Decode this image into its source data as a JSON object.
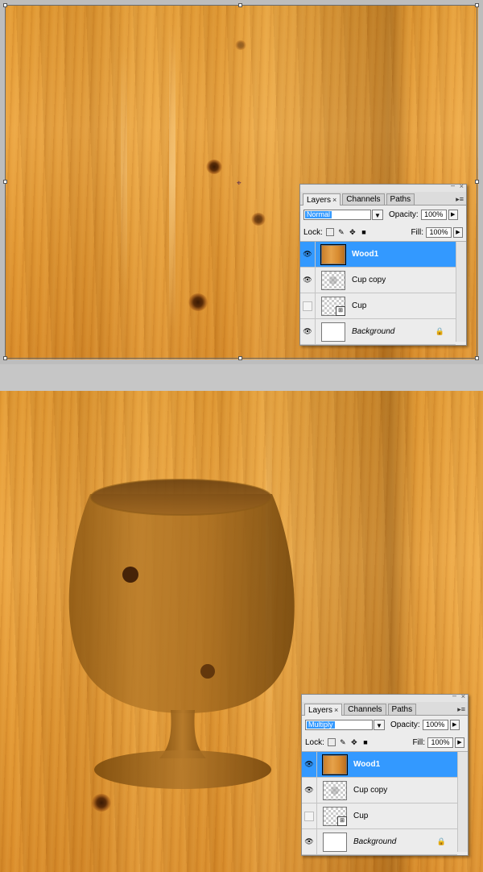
{
  "panel_top": {
    "tabs": [
      {
        "label": "Layers",
        "close": "×"
      },
      {
        "label": "Channels"
      },
      {
        "label": "Paths"
      }
    ],
    "blend_mode": "Normal",
    "opacity_label": "Opacity:",
    "opacity_value": "100%",
    "lock_label": "Lock:",
    "fill_label": "Fill:",
    "fill_value": "100%",
    "layers": [
      {
        "name": "Wood1"
      },
      {
        "name": "Cup copy"
      },
      {
        "name": "Cup"
      },
      {
        "name": "Background"
      }
    ]
  },
  "panel_bottom": {
    "tabs": [
      {
        "label": "Layers",
        "close": "×"
      },
      {
        "label": "Channels"
      },
      {
        "label": "Paths"
      }
    ],
    "blend_mode": "Multiply",
    "opacity_label": "Opacity:",
    "opacity_value": "100%",
    "lock_label": "Lock:",
    "fill_label": "Fill:",
    "fill_value": "100%",
    "layers": [
      {
        "name": "Wood1"
      },
      {
        "name": "Cup copy"
      },
      {
        "name": "Cup"
      },
      {
        "name": "Background"
      }
    ]
  },
  "icons": {
    "eye": "eye-icon",
    "lock": "lock-icon",
    "smart_object": "smart-object-icon",
    "dropdown": "chevron-down-icon",
    "stepper": "chevron-right-icon",
    "panel_menu": "panel-menu-icon"
  },
  "colors": {
    "selection": "#3399ff",
    "wood": "#e39a33",
    "panel_bg": "#ececec"
  }
}
